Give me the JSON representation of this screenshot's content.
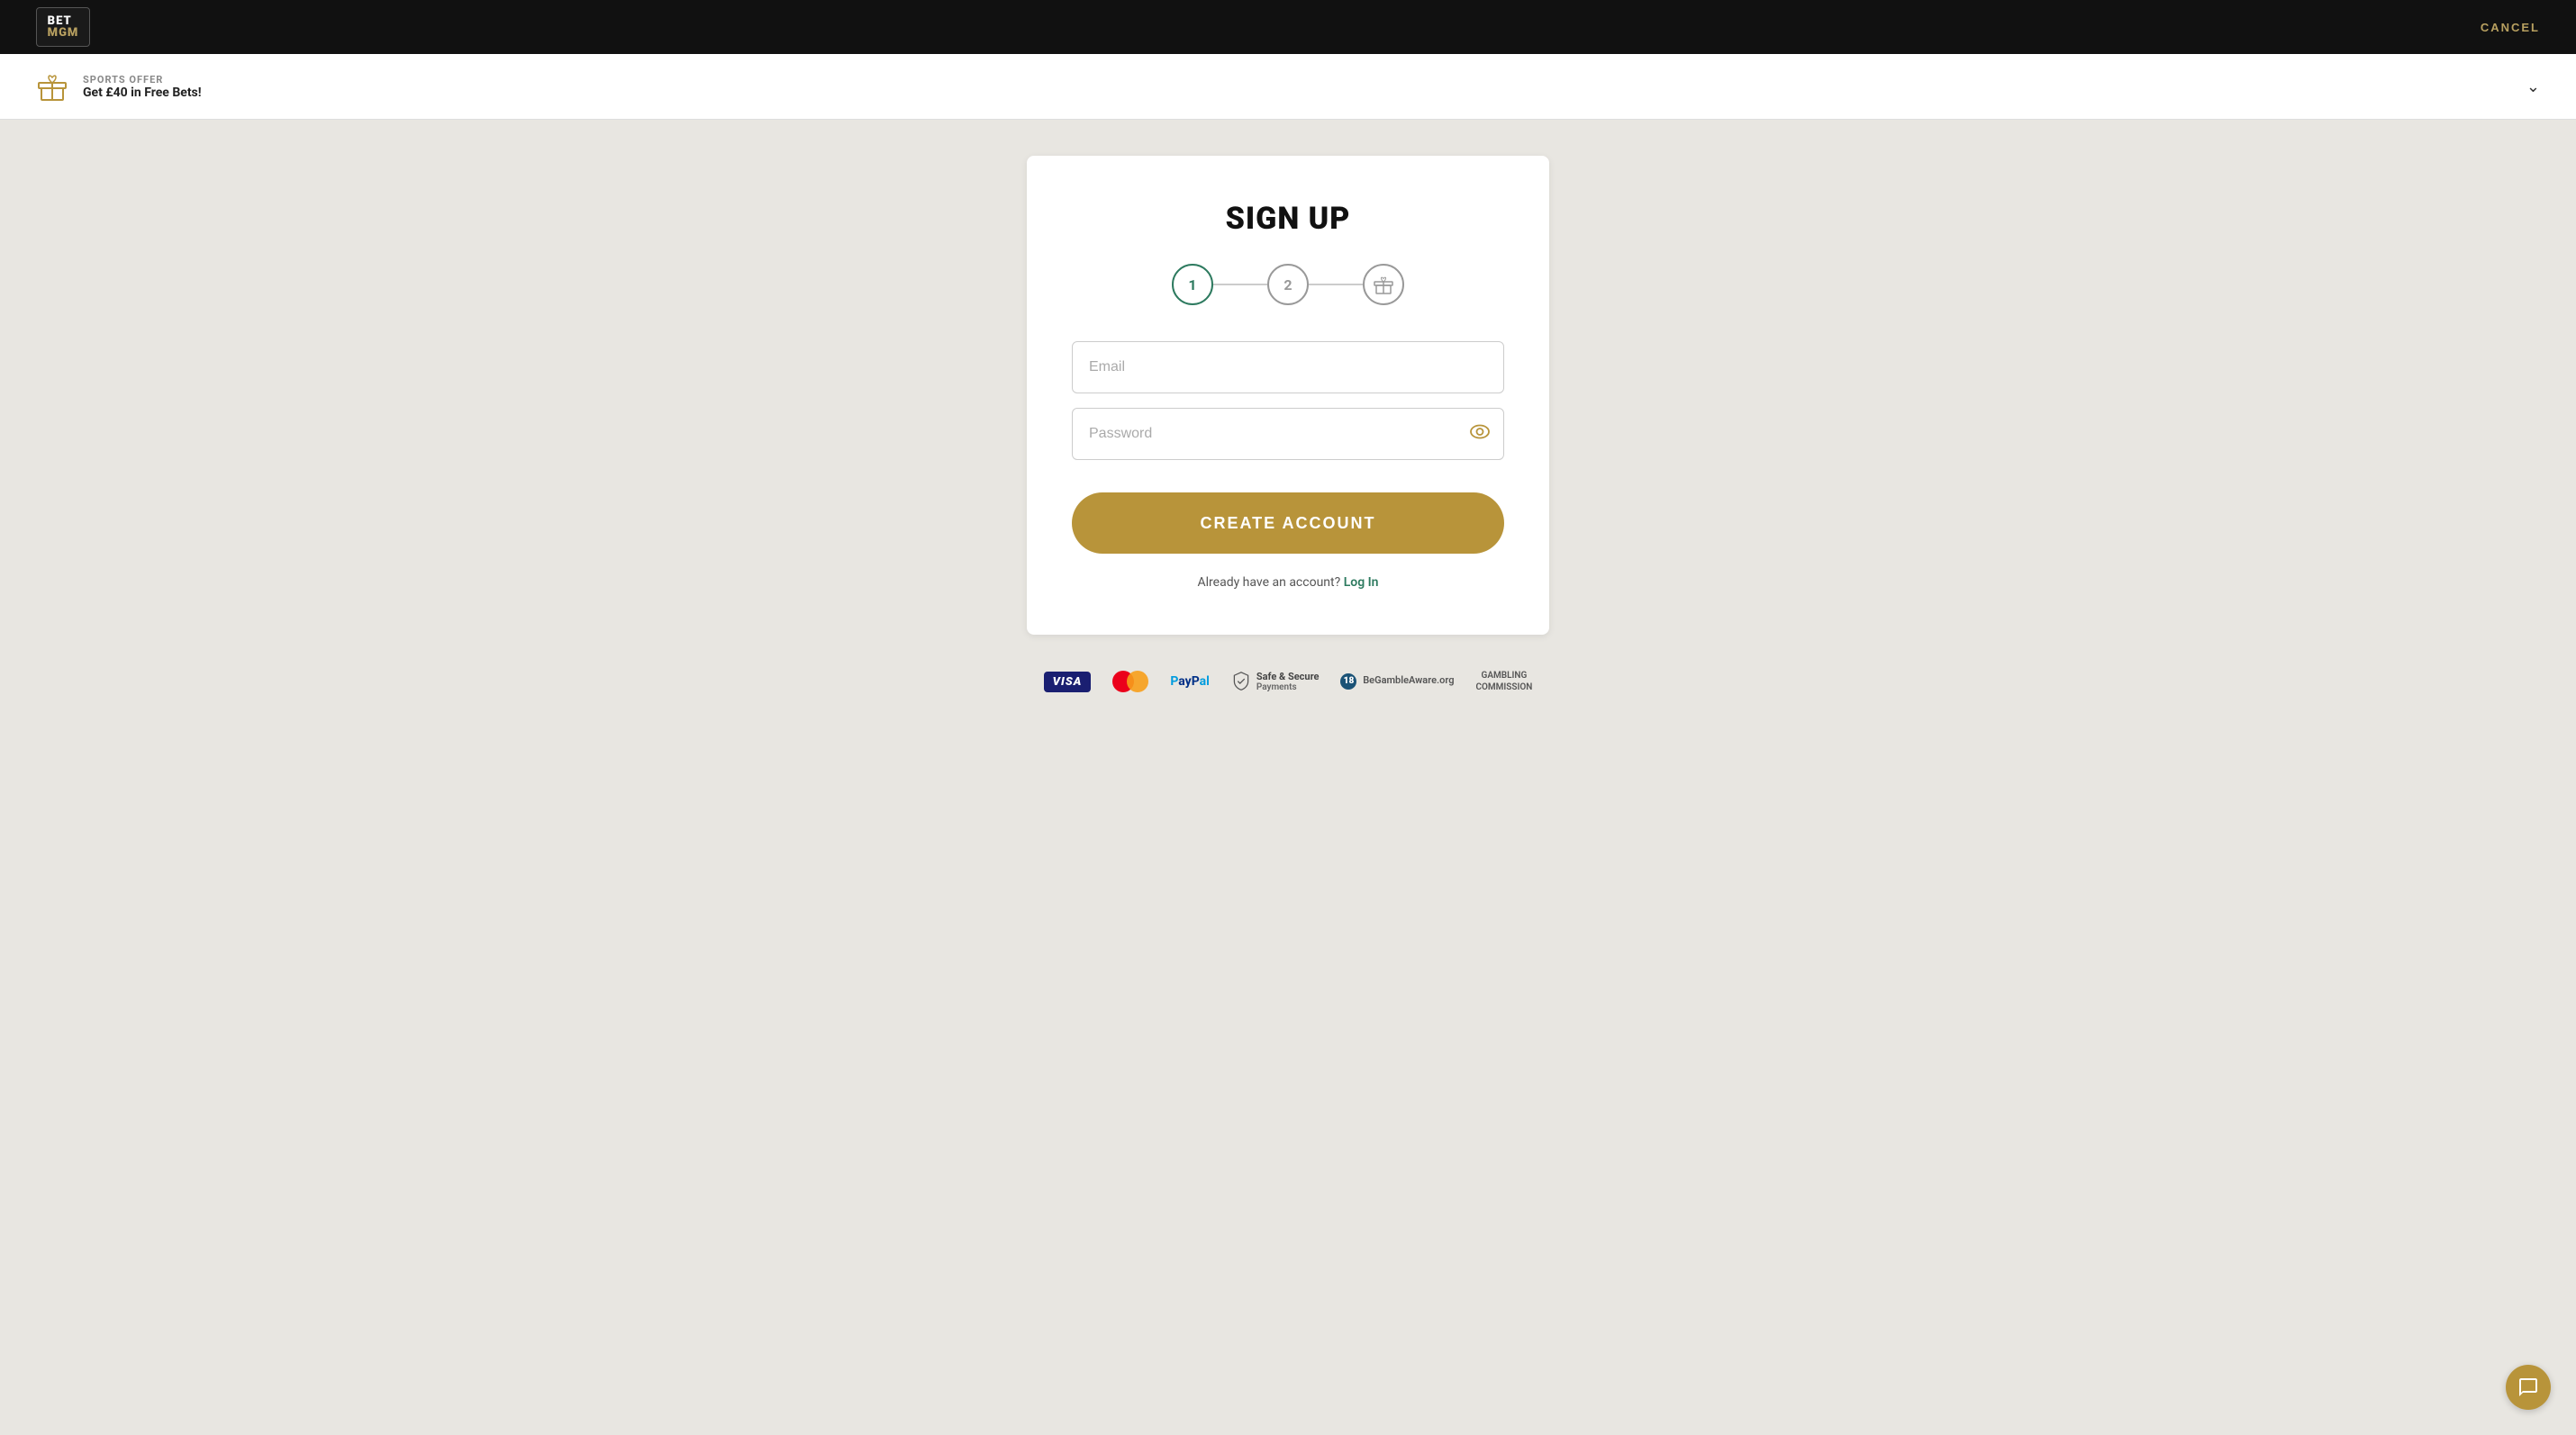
{
  "header": {
    "logo_bet": "BET",
    "logo_mgm": "MGM",
    "cancel_label": "CANCEL"
  },
  "offer_banner": {
    "label": "SPORTS OFFER",
    "description": "Get £40 in Free Bets!"
  },
  "signup": {
    "title": "SIGN UP",
    "step1_label": "1",
    "step2_label": "2",
    "email_placeholder": "Email",
    "password_placeholder": "Password",
    "create_account_label": "CREATE ACCOUNT",
    "already_text": "Already have an account?",
    "login_label": "Log In"
  },
  "footer": {
    "safe_secure_label": "Safe & Secure",
    "payments_label": "Payments",
    "gambleware_label": "BeGambleAware.org",
    "gambling_commission_line1": "GAMBLING",
    "gambling_commission_line2": "COMMISSION"
  }
}
